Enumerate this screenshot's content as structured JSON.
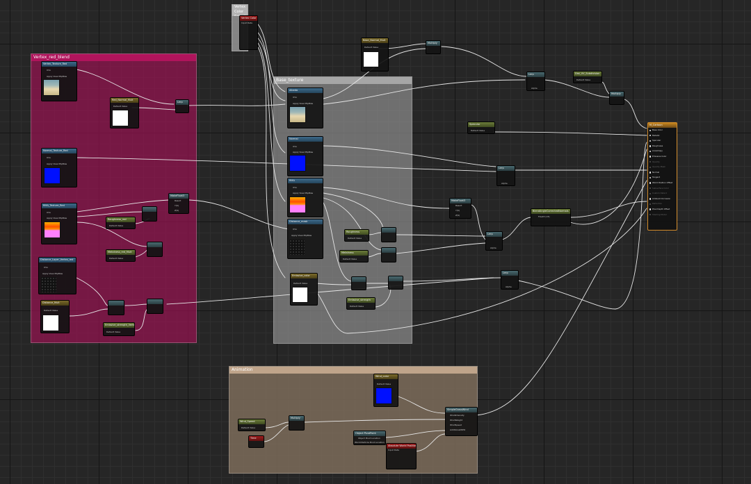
{
  "comments": {
    "vertex_color": "Vertex Color Selection",
    "red_blend": "Vertex_red_blend",
    "base_texture": "Base_texture",
    "animation": "Animation"
  },
  "colors": {
    "red_comment": "#b0145c",
    "grey_comment": "#a6a6a6",
    "anim_comment": "#bfa48a",
    "main_node_border": "#d08a2a",
    "blue_swatch": "#0010ff",
    "white_swatch": "#ffffff",
    "pink_swatch": "#ff80ff",
    "orange_band": "#ff8a00"
  },
  "main_node": {
    "title": "M_Cartoon",
    "pins": [
      {
        "label": "Base Color",
        "active": true
      },
      {
        "label": "Metallic",
        "active": true
      },
      {
        "label": "Specular",
        "active": true
      },
      {
        "label": "Roughness",
        "active": true
      },
      {
        "label": "Anisotropy",
        "active": true
      },
      {
        "label": "Emissive Color",
        "active": true
      },
      {
        "label": "Opacity",
        "active": false
      },
      {
        "label": "Opacity Mask",
        "active": false
      },
      {
        "label": "Normal",
        "active": true
      },
      {
        "label": "Tangent",
        "active": true
      },
      {
        "label": "World Position Offset",
        "active": true
      },
      {
        "label": "Subsurface Color",
        "active": false
      },
      {
        "label": "Custom Data 0",
        "active": false
      },
      {
        "label": "Ambient Occlusion",
        "active": true
      },
      {
        "label": "Refraction",
        "active": false
      },
      {
        "label": "Pixel Depth Offset",
        "active": true
      },
      {
        "label": "Shading Model",
        "active": false
      }
    ]
  },
  "nodes": {
    "vertex_color": {
      "title": "Vertex Color",
      "sub": "Input Data"
    },
    "t_red_base": {
      "title": "Vertex_Texture_Red",
      "sub": "Param2D",
      "uvs": "UVs",
      "view": "Apply View MipBias"
    },
    "red_white_param": {
      "title": "Red_Normal_Mult",
      "default": "Default Value"
    },
    "red_lerp1": {
      "title": "Lerp"
    },
    "t_red_norm": {
      "title": "Normal_Texture_Red",
      "sub": "Param2D",
      "uvs": "UVs",
      "view": "Apply View MipBias"
    },
    "t_red_pink": {
      "title": "RMA_Texture_Red",
      "sub": "Param2D",
      "uvs": "UVs",
      "view": "Apply View MipBias"
    },
    "mask1": {
      "title": "MakeFloat3",
      "r": "Result",
      "y": "Y(S)",
      "z": "Z(S)"
    },
    "rough_red": {
      "title": "Roughness_red",
      "sub": "Param",
      "default": "Default Value"
    },
    "metal_red": {
      "title": "Metalness_red_Mult",
      "sub": "Param",
      "default": "Default Value"
    },
    "t_red_dist": {
      "title": "Distance_Layer_Vertex_red",
      "sub": "Param2D",
      "uvs": "UVs",
      "view": "Apply View MipBias"
    },
    "white_red2": {
      "title": "Distance_Mult",
      "sub": "Param",
      "default": "Default Value"
    },
    "emissive_red": {
      "title": "Emissive_strength_Vertex_red",
      "sub": "Param",
      "default": "Default Value"
    },
    "t_base": {
      "title": "Albedo",
      "sub": "Param2D",
      "uvs": "UVs",
      "view": "Apply View MipBias"
    },
    "t_base_norm": {
      "title": "Normal",
      "sub": "Param2D",
      "uvs": "UVs",
      "view": "Apply View MipBias"
    },
    "t_base_rma": {
      "title": "RMA",
      "sub": "Param2D",
      "uvs": "UVs",
      "view": "Apply View MipBias"
    },
    "t_base_dist": {
      "title": "Distance_mask",
      "sub": "Param2D",
      "uvs": "UVs",
      "view": "Apply View MipBias"
    },
    "base_rough": {
      "title": "Roughness",
      "sub": "Param",
      "default": "Default Value"
    },
    "base_metal": {
      "title": "Metalness",
      "sub": "Param",
      "default": "Default Value"
    },
    "base_white": {
      "title": "Emissive_color",
      "sub": "Param",
      "default": "Default Value"
    },
    "base_emis": {
      "title": "Emissive_strength",
      "sub": "Param",
      "default": "Default Value"
    },
    "top_white": {
      "title": "Base_Normal_Mult",
      "default": "Default Value"
    },
    "mult_top": {
      "title": "Multiply"
    },
    "lerp_a": {
      "title": "Lerp",
      "alpha": "Alpha"
    },
    "lerp_b": {
      "title": "Lerp",
      "alpha": "Alpha"
    },
    "lerp_c": {
      "title": "Lerp",
      "alpha": "Alpha"
    },
    "lerp_d": {
      "title": "Lerp",
      "alpha": "Alpha"
    },
    "oneminus": {
      "title": "Dist_UV_Subdivision",
      "sub": "Param",
      "default": "Default Value"
    },
    "mult_final": {
      "title": "Multiply"
    },
    "specular": {
      "title": "Specular",
      "sub": "Param",
      "default": "Default Value"
    },
    "break3": {
      "title": "MakeFloat3",
      "r": "Result",
      "y": "Y(S)",
      "z": "Z(S)"
    },
    "brightness": {
      "title": "BlendAngleCorrectedNormals",
      "sub": "Float3 (V3)"
    },
    "anim_blue": {
      "title": "Wind_color",
      "sub": "Param",
      "default": "Default Value"
    },
    "anim_param": {
      "title": "Wind_Speed",
      "sub": "Param",
      "default": "Default Value"
    },
    "anim_time": {
      "title": "Time"
    },
    "anim_mult": {
      "title": "Multiply"
    },
    "simple_grass": {
      "title": "SimpleGrassWind",
      "p1": "WindIntensity",
      "p2": "WindWeight",
      "p3": "WindSpeed",
      "p4": "AdditionalWPO"
    },
    "object_pivot": {
      "title": "Object PivotPoint",
      "p1": "Object Pivot Location",
      "p2": "World Particle Pivot Location"
    },
    "world_pos": {
      "title": "Absolute World Position",
      "sub": "Input Data"
    }
  }
}
